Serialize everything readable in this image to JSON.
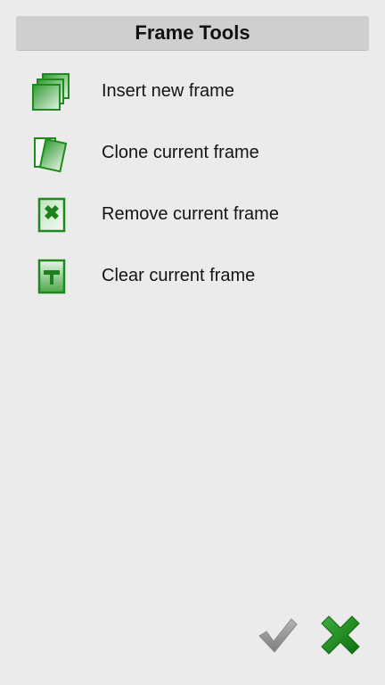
{
  "dialog": {
    "title": "Frame Tools"
  },
  "menu": {
    "items": [
      {
        "label": "Insert new frame",
        "icon": "insert-frame-icon"
      },
      {
        "label": "Clone current frame",
        "icon": "clone-frame-icon"
      },
      {
        "label": "Remove current frame",
        "icon": "remove-frame-icon"
      },
      {
        "label": "Clear current frame",
        "icon": "clear-frame-icon"
      }
    ]
  },
  "actions": {
    "confirm": {
      "icon": "checkmark-icon",
      "enabled": false
    },
    "cancel": {
      "icon": "close-icon"
    }
  },
  "colors": {
    "background": "#ebebeb",
    "title_bar": "#cfcfcf",
    "accent_green": "#1e8a1e",
    "disabled_gray": "#9a9a9a"
  }
}
